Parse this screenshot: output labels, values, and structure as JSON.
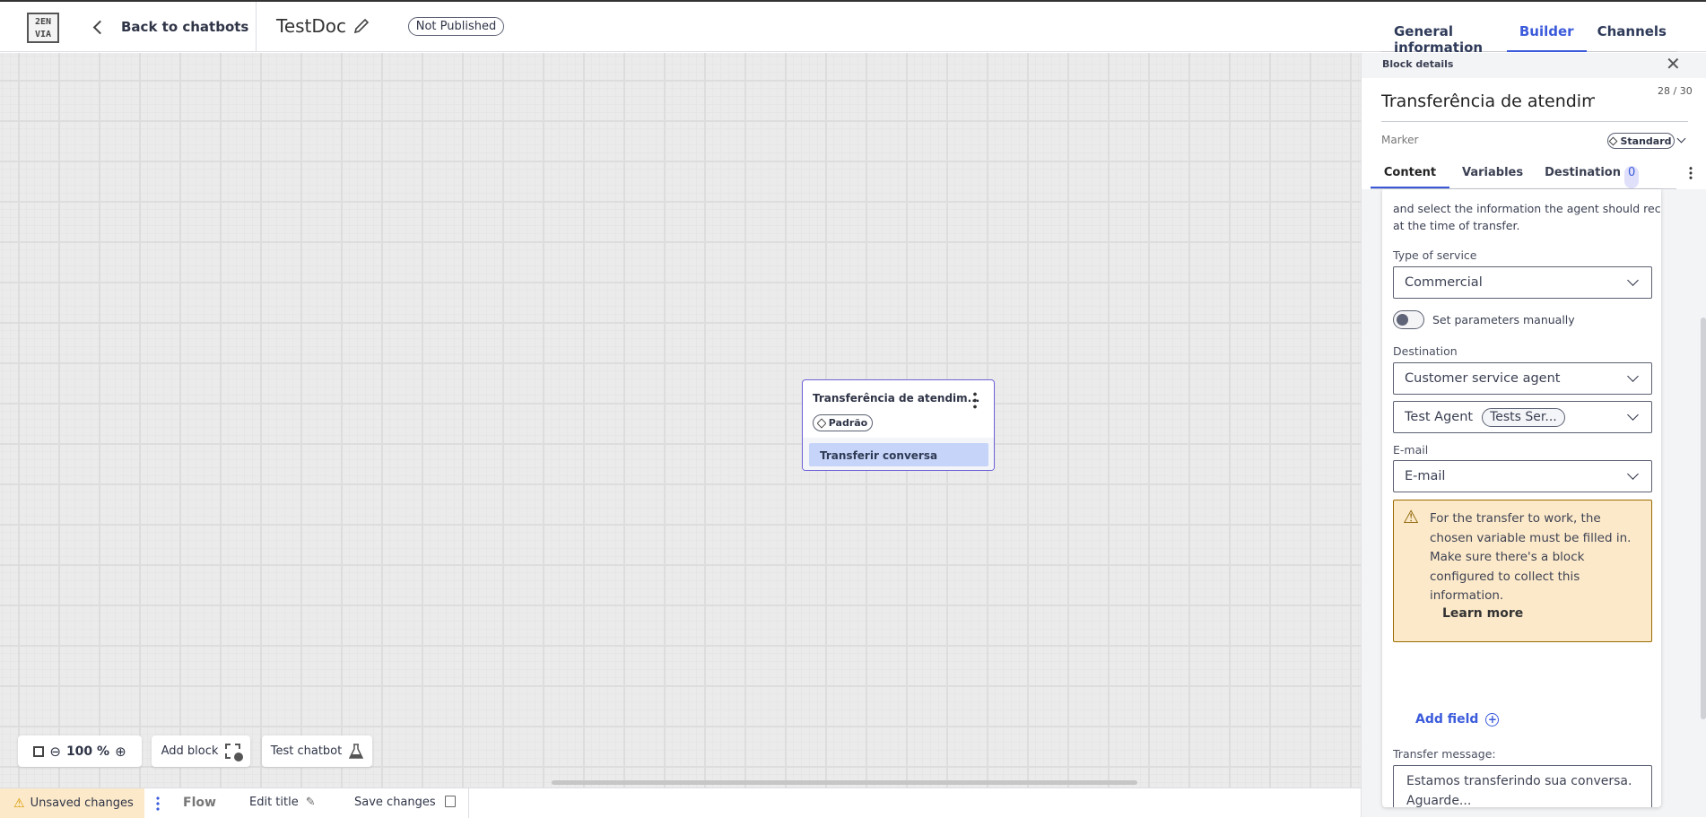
{
  "header": {
    "logo_text": "2EN VIA",
    "back_label": "Back to chatbots",
    "doc_title": "TestDoc",
    "status_badge": "Not Published",
    "tabs": [
      {
        "label": "General information",
        "active": false
      },
      {
        "label": "Builder",
        "active": true
      },
      {
        "label": "Channels",
        "active": false
      }
    ]
  },
  "canvas": {
    "node": {
      "title": "Transferência de atendim...",
      "marker": "Padrão",
      "option": "Transferir conversa"
    },
    "toolbar": {
      "zoom": "100 %",
      "add_block": "Add block",
      "test_chatbot": "Test chatbot"
    }
  },
  "bottom_bar": {
    "unsaved": "Unsaved changes",
    "flow": "Flow",
    "edit_title": "Edit title",
    "save": "Save changes"
  },
  "panel": {
    "header": "Block details",
    "title_value": "Transferência de atendimento",
    "counter": "28 / 30",
    "marker_label": "Marker",
    "marker_value": "Standard",
    "tabs": [
      {
        "label": "Content",
        "active": true
      },
      {
        "label": "Variables"
      },
      {
        "label": "Destination",
        "badge": "0"
      }
    ],
    "content": {
      "intro_line1": "and select the information the agent should receive",
      "intro_line2": "at the time of transfer.",
      "type_label": "Type of service",
      "type_value": "Commercial",
      "toggle_label": "Set parameters manually",
      "toggle_on": false,
      "destination_label": "Destination",
      "destination_value": "Customer service agent",
      "agent_value": "Test Agent",
      "agent_tag": "Tests Ser...",
      "email_label": "E-mail",
      "email_value": "E-mail",
      "warning": "For the transfer to work, the chosen variable must be filled in. Make sure there's a block configured to collect this information.",
      "learn_more": "Learn more",
      "add_field": "Add field",
      "transfer_label": "Transfer message:",
      "transfer_value": "Estamos transferindo sua conversa. Aguarde..."
    }
  },
  "colors": {
    "accent": "#3b5bdb",
    "warning_bg": "#fce9c9",
    "warning_border": "#9a6b00",
    "node_border": "#6e63d8",
    "node_option_bg": "#c5d4f8"
  }
}
